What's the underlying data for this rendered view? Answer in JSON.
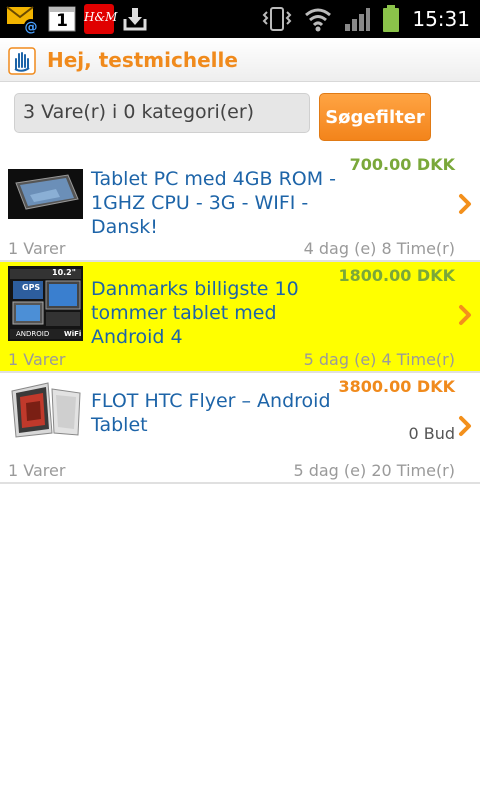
{
  "statusbar": {
    "time": "15:31",
    "notif_icons": [
      "mail-at-icon",
      "calendar-1-icon",
      "hm-app-icon",
      "download-icon"
    ],
    "calendar_day": "1",
    "hm_label": "H&M",
    "system_icons": [
      "vibrate-icon",
      "wifi-icon",
      "signal-icon",
      "battery-icon"
    ]
  },
  "header": {
    "title": "Hej, testmichelle",
    "icon": "hand-icon",
    "accent": "#f08a1c"
  },
  "search": {
    "value": "3 Vare(r) i 0 kategori(er)",
    "filter_label": "Søgefilter"
  },
  "items": [
    {
      "title": "Tablet PC med 4GB ROM - 1GHZ CPU - 3G - WIFI - Dansk!",
      "price": "700.00 DKK",
      "price_color": "#7aa83a",
      "qty": "1 Varer",
      "time_left": "4 dag (e) 8 Time(r)",
      "bids": "",
      "highlight": false
    },
    {
      "title": "Danmarks billigste 10 tommer tablet med Android 4",
      "price": "1800.00 DKK",
      "price_color": "#7aa83a",
      "qty": "1 Varer",
      "time_left": "5 dag (e) 4 Time(r)",
      "bids": "",
      "highlight": true,
      "thumb_text": [
        "10.2\"",
        "GPS",
        "ANDROID",
        "WiFi"
      ]
    },
    {
      "title": "FLOT HTC Flyer – Android Tablet",
      "price": "3800.00 DKK",
      "price_color": "#f08a1c",
      "qty": "1 Varer",
      "time_left": "5 dag (e) 20 Time(r)",
      "bids": "0 Bud",
      "highlight": false
    }
  ]
}
